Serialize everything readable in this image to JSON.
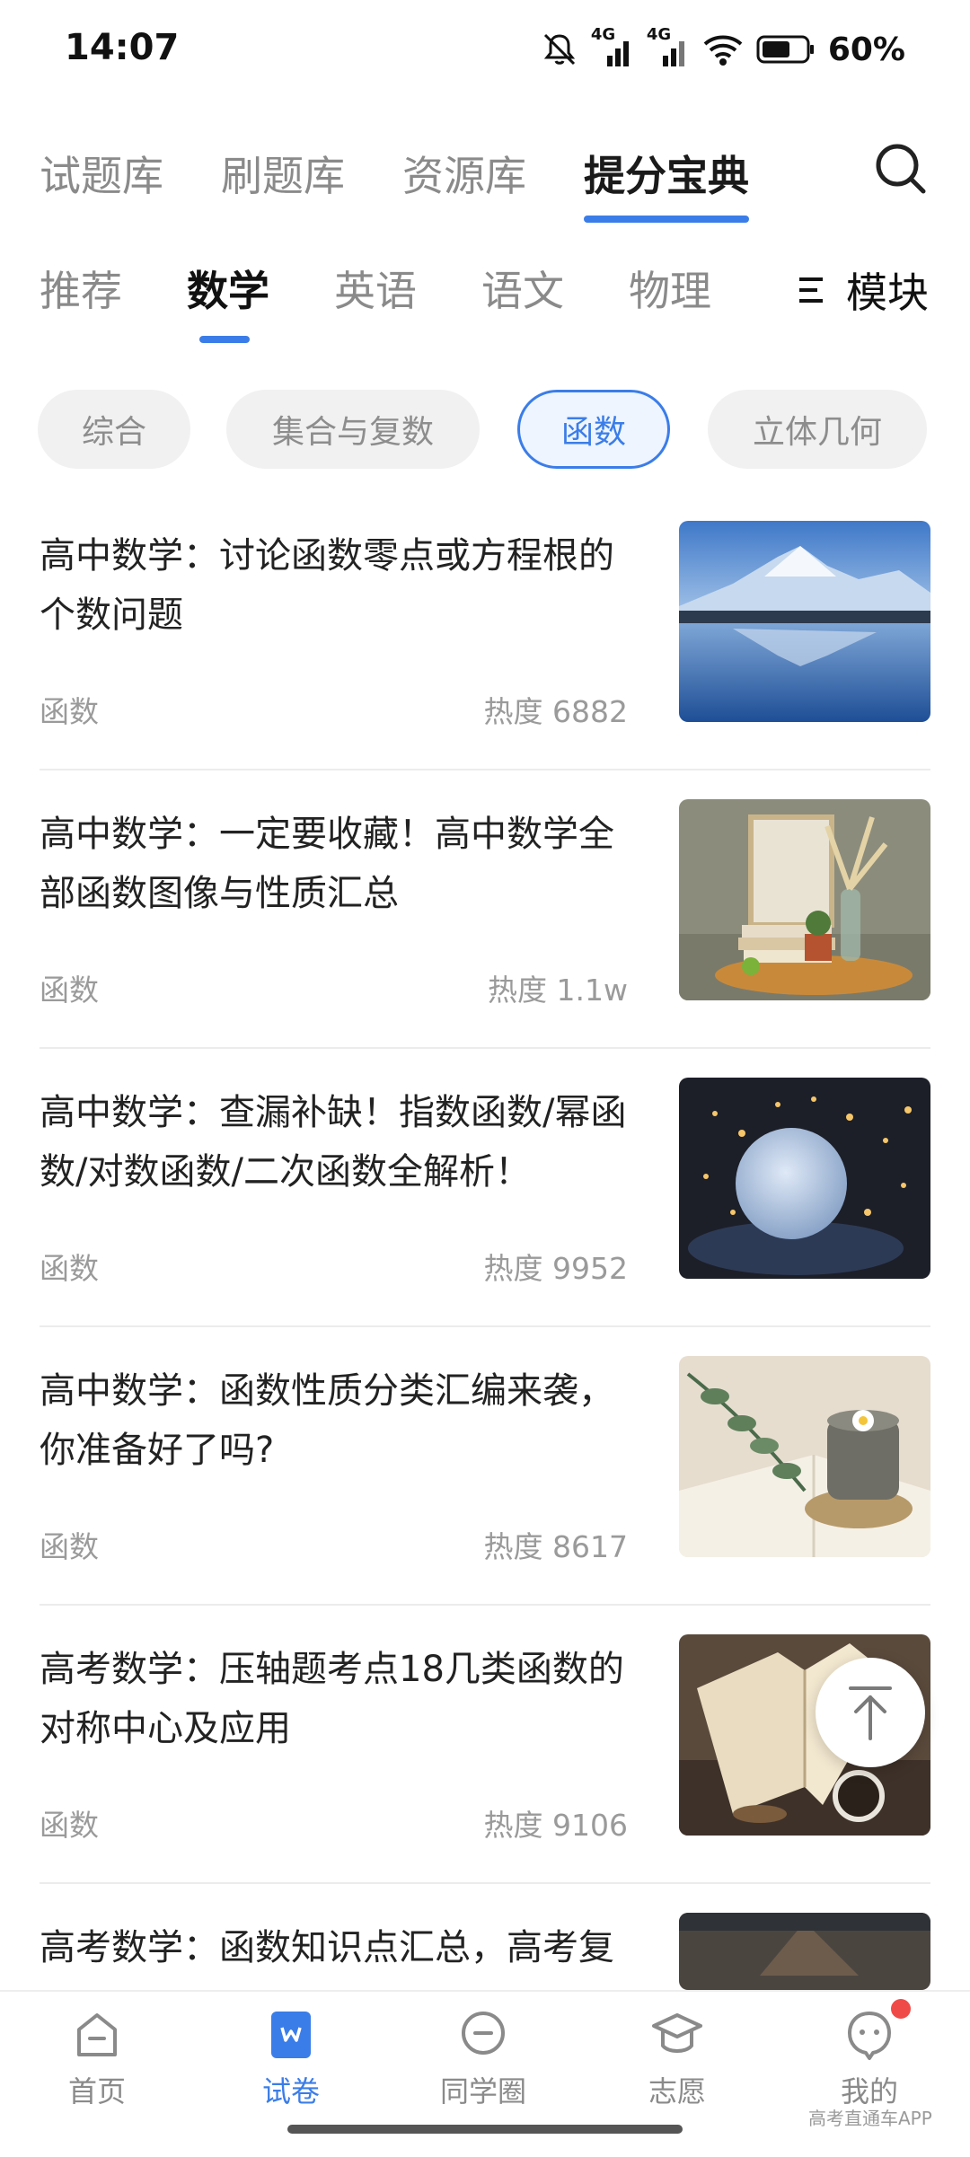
{
  "status": {
    "time": "14:07",
    "network_label_1": "4G",
    "network_label_2": "4G",
    "battery": "60%"
  },
  "top_tabs": [
    {
      "label": "试题库"
    },
    {
      "label": "刷题库"
    },
    {
      "label": "资源库"
    },
    {
      "label": "提分宝典",
      "active": true
    }
  ],
  "subject_tabs": [
    {
      "label": "推荐"
    },
    {
      "label": "数学",
      "active": true
    },
    {
      "label": "英语"
    },
    {
      "label": "语文"
    },
    {
      "label": "物理"
    }
  ],
  "modules_label": "模块",
  "chips": [
    {
      "label": "综合"
    },
    {
      "label": "集合与复数"
    },
    {
      "label": "函数",
      "active": true
    },
    {
      "label": "立体几何"
    }
  ],
  "articles": [
    {
      "title": "高中数学：讨论函数零点或方程根的个数问题",
      "tag": "函数",
      "heat": "热度 6882",
      "image": "mountain-lake-image"
    },
    {
      "title": "高中数学：一定要收藏！高中数学全部函数图像与性质汇总",
      "tag": "函数",
      "heat": "热度 1.1w",
      "image": "chair-frame-image"
    },
    {
      "title": "高中数学：查漏补缺！指数函数/幂函数/对数函数/二次函数全解析！",
      "tag": "函数",
      "heat": "热度 9952",
      "image": "moon-lamp-image"
    },
    {
      "title": "高中数学：函数性质分类汇编来袭，你准备好了吗?",
      "tag": "函数",
      "heat": "热度 8617",
      "image": "cup-book-image"
    },
    {
      "title": "高考数学：压轴题考点18几类函数的对称中心及应用",
      "tag": "函数",
      "heat": "热度 9106",
      "image": "open-book-image"
    },
    {
      "title": "高考数学：函数知识点汇总，高考复",
      "tag": "",
      "heat": "",
      "image": "dark-image"
    }
  ],
  "bottom_nav": [
    {
      "label": "首页"
    },
    {
      "label": "试卷",
      "active": true
    },
    {
      "label": "同学圈"
    },
    {
      "label": "志愿"
    },
    {
      "label": "我的"
    }
  ],
  "watermark": "高考直通车APP",
  "colors": {
    "accent": "#3b7de8",
    "badge": "#f04a48"
  }
}
